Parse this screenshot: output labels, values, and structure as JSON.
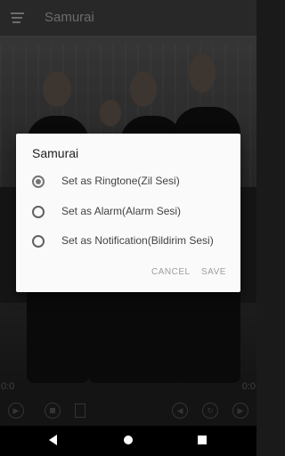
{
  "app_bar": {
    "title": "Samurai",
    "menu_icon": "menu-icon"
  },
  "player": {
    "time_left": "0:0",
    "time_right": "0:0",
    "controls": [
      "play-icon",
      "stop-icon",
      "exit-icon",
      "previous-icon",
      "repeat-icon",
      "next-icon"
    ]
  },
  "dialog": {
    "title": "Samurai",
    "options": [
      {
        "label": "Set as Ringtone(Zil Sesi)",
        "selected": true
      },
      {
        "label": "Set as Alarm(Alarm Sesi)",
        "selected": false
      },
      {
        "label": "Set as Notification(Bildirim Sesi)",
        "selected": false
      }
    ],
    "cancel_label": "CANCEL",
    "save_label": "SAVE"
  },
  "navbar": {
    "icons": [
      "back-icon",
      "home-icon",
      "recents-icon"
    ]
  }
}
